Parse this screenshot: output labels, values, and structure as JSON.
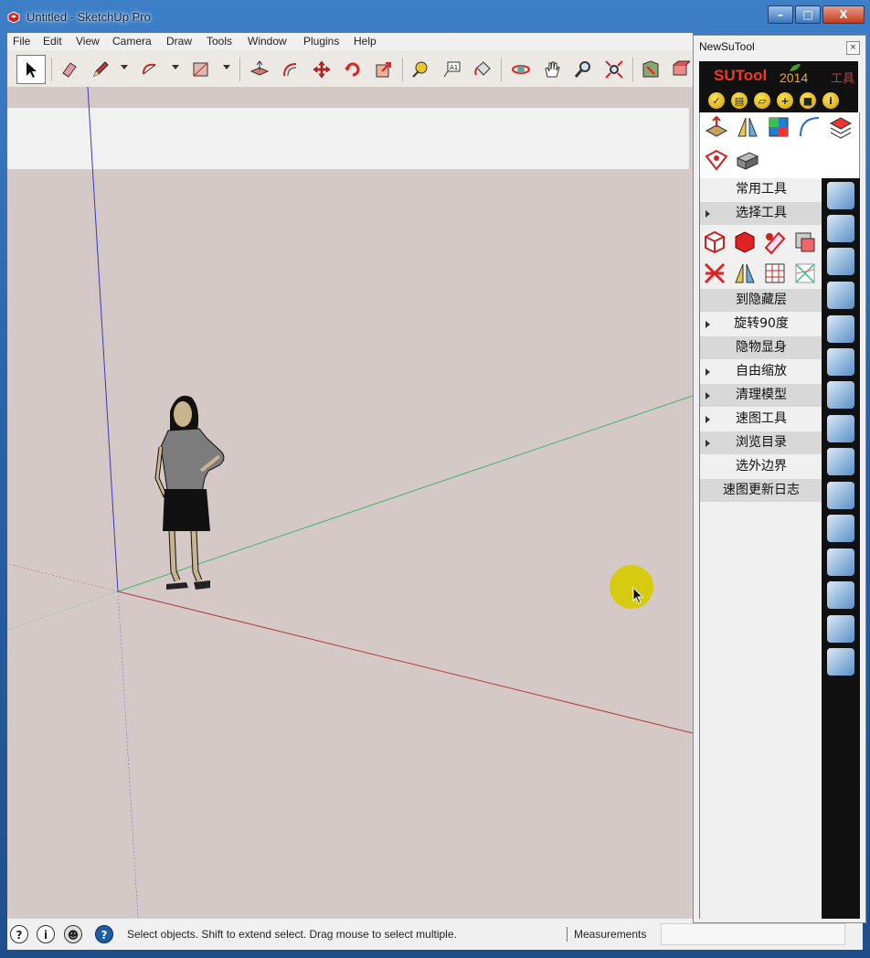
{
  "window": {
    "title": "Untitled - SketchUp Pro",
    "controls": [
      "–",
      "□",
      "X"
    ]
  },
  "menu": {
    "items": [
      "File",
      "Edit",
      "View",
      "Camera",
      "Draw",
      "Tools",
      "Window",
      "Plugins",
      "Help"
    ]
  },
  "toolbar": {
    "tools": [
      {
        "name": "select",
        "icon": "select-arrow-icon"
      },
      {
        "name": "eraser",
        "icon": "eraser-icon"
      },
      {
        "name": "pencil",
        "icon": "pencil-icon"
      },
      {
        "name": "arc",
        "icon": "arc-icon"
      },
      {
        "name": "shapes",
        "icon": "rectangle-icon"
      },
      {
        "name": "push-pull",
        "icon": "push-pull-icon"
      },
      {
        "name": "offset",
        "icon": "offset-icon"
      },
      {
        "name": "move",
        "icon": "move-icon"
      },
      {
        "name": "rotate",
        "icon": "rotate-icon"
      },
      {
        "name": "scale",
        "icon": "scale-icon"
      },
      {
        "name": "tape-measure",
        "icon": "tape-measure-icon"
      },
      {
        "name": "text",
        "icon": "text-icon"
      },
      {
        "name": "paint-bucket",
        "icon": "paint-bucket-icon"
      },
      {
        "name": "orbit",
        "icon": "orbit-icon"
      },
      {
        "name": "pan",
        "icon": "pan-hand-icon"
      },
      {
        "name": "zoom",
        "icon": "zoom-icon"
      },
      {
        "name": "zoom-extents",
        "icon": "zoom-extents-icon"
      },
      {
        "name": "warehouse",
        "icon": "warehouse-icon"
      },
      {
        "name": "extension",
        "icon": "extension-icon"
      }
    ]
  },
  "statusbar": {
    "hint": "Select objects. Shift to extend select. Drag mouse to select multiple.",
    "measurements_label": "Measurements",
    "icons": [
      "geo-location-icon",
      "credits-icon",
      "user-icon",
      "help-icon"
    ]
  },
  "panel": {
    "title": "NewSuTool",
    "close": "×",
    "logo": "SUTool",
    "year": "2014",
    "tool_label": "工具",
    "header_buttons": [
      "check-icon",
      "clipboard-icon",
      "trash-icon",
      "add-icon",
      "save-icon",
      "info-icon"
    ],
    "menu": [
      {
        "label": "常用工具",
        "arrow": false
      },
      {
        "label": "选择工具",
        "arrow": true
      },
      {
        "label": "到隐藏层",
        "arrow": false
      },
      {
        "label": "旋转90度",
        "arrow": true
      },
      {
        "label": "隐物显身",
        "arrow": false
      },
      {
        "label": "自由缩放",
        "arrow": true
      },
      {
        "label": "清理模型",
        "arrow": true
      },
      {
        "label": "速图工具",
        "arrow": true
      },
      {
        "label": "浏览目录",
        "arrow": true
      },
      {
        "label": "选外边界",
        "arrow": false
      },
      {
        "label": "速图更新日志",
        "arrow": false
      }
    ]
  },
  "colors": {
    "axis_blue": "#3b3bb8",
    "axis_green": "#3fb36a",
    "axis_red": "#b23a3a",
    "viewport_bg": "#d5c9c8",
    "cursor_highlight": "#d7cb12"
  }
}
